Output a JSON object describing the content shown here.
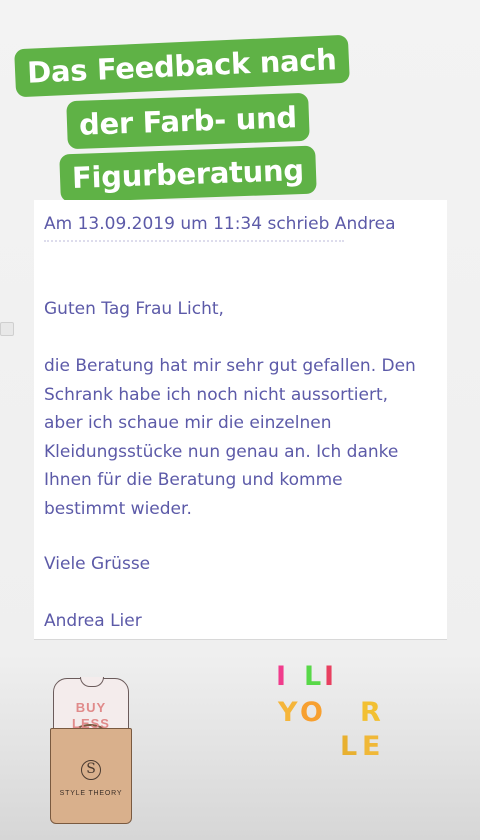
{
  "banner": {
    "lines": [
      "Das Feedback nach",
      "der Farb- und",
      "Figurberatung"
    ],
    "color": "#5fb246"
  },
  "email": {
    "header": "Am 13.09.2019 um 11:34 schrieb Andrea",
    "greeting": "Guten Tag Frau Licht,",
    "body_lines": [
      "die Beratung hat mir sehr gut gefallen. Den",
      "Schrank habe ich noch nicht aussortiert,",
      "aber ich schaue mir die einzelnen",
      "Kleidungsstücke nun genau an. Ich danke",
      "Ihnen für die Beratung und komme",
      "bestimmt wieder."
    ],
    "closing": "Viele Grüsse",
    "signature": "Andrea Lier",
    "text_color": "#5c5aa8"
  },
  "stickers": {
    "bag": {
      "line1": "BUY",
      "line2": "LESS",
      "logo": "S",
      "brand": "STYLE THEORY"
    },
    "letters": [
      {
        "char": "I",
        "color": "#f03c8c"
      },
      {
        "char": "L",
        "color": "#58d848"
      },
      {
        "char": "I",
        "color": "#e84060"
      },
      {
        "char": "Y",
        "color": "#f5b53a"
      },
      {
        "char": "O",
        "color": "#f7a030"
      },
      {
        "char": "R",
        "color": "#f2c033"
      },
      {
        "char": "L",
        "color": "#e8b030"
      },
      {
        "char": "E",
        "color": "#f0b838"
      }
    ]
  }
}
